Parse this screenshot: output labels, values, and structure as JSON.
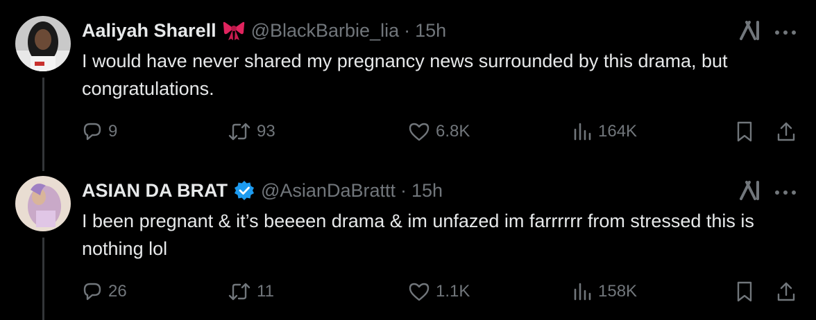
{
  "tweets": [
    {
      "name": "Aaliyah Sharell",
      "badge_icon": "bow-emoji-icon",
      "handle": "@BlackBarbie_lia",
      "separator": "·",
      "time": "15h",
      "text": "I would have never shared my pregnancy news surrounded by this drama, but congratulations.",
      "replies": "9",
      "retweets": "93",
      "likes": "6.8K",
      "views": "164K"
    },
    {
      "name": "ASIAN DA BRAT",
      "badge_icon": "verified-badge-icon",
      "handle": "@AsianDaBrattt",
      "separator": "·",
      "time": "15h",
      "text": "I been pregnant & it’s beeeen drama & im unfazed im farrrrrr from stressed this is nothing lol",
      "replies": "26",
      "retweets": "11",
      "likes": "1.1K",
      "views": "158K"
    }
  ],
  "colors": {
    "background": "#000000",
    "text": "#e7e9ea",
    "secondary": "#71767b",
    "verified": "#1d9bf0",
    "bow": "#e0245e"
  }
}
